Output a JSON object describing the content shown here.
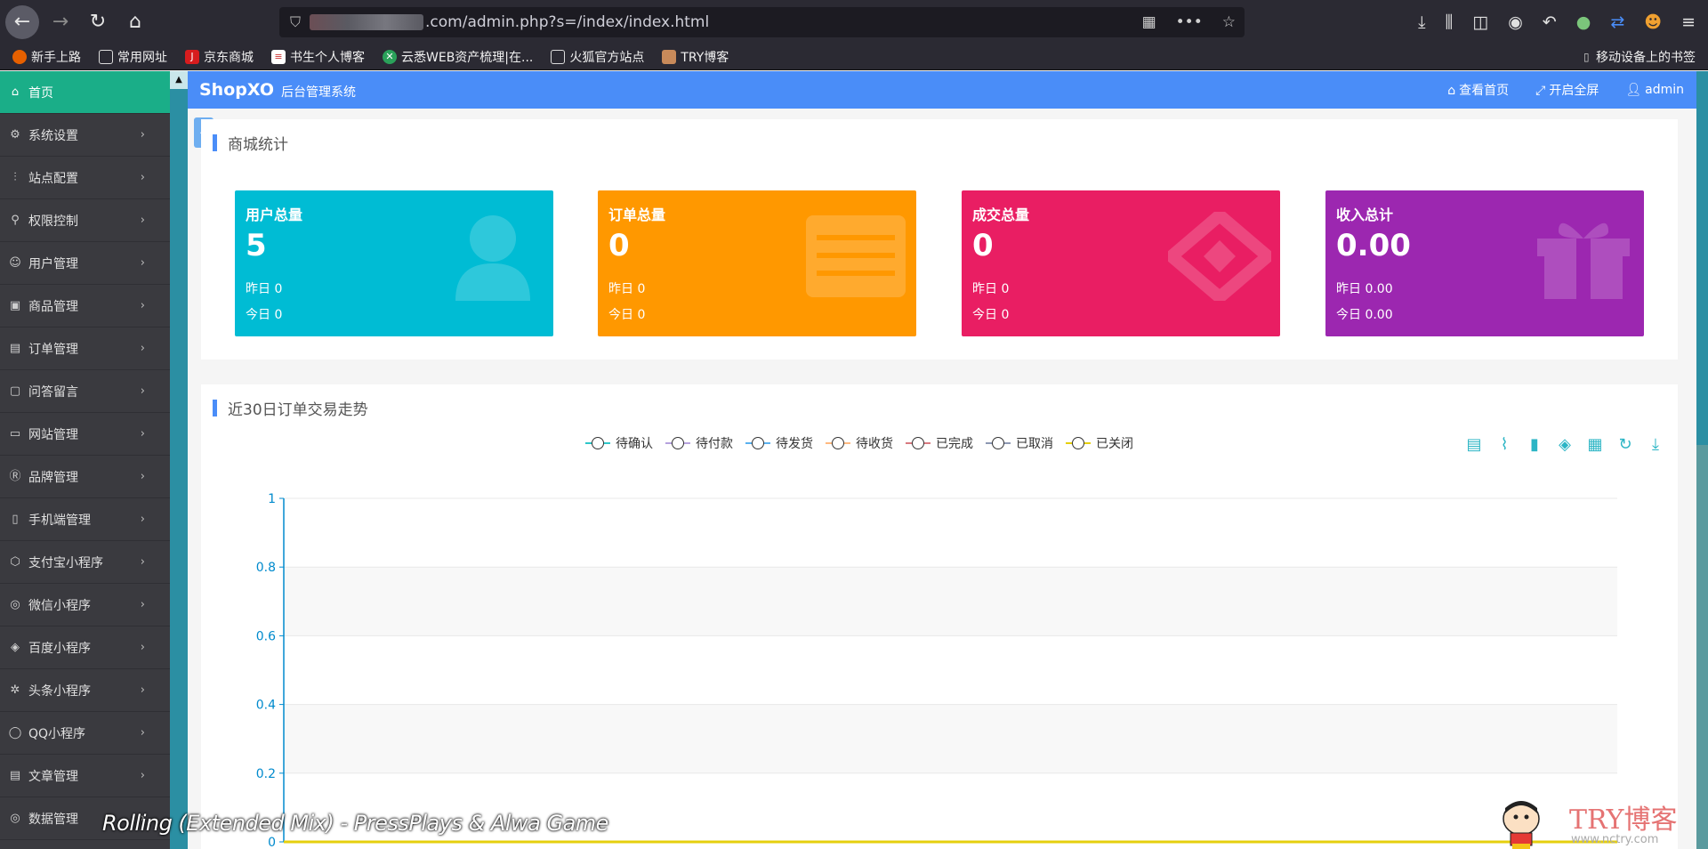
{
  "browser": {
    "url_suffix": ".com/admin.php?s=/index/index.html",
    "bookmarks": [
      "新手上路",
      "常用网址",
      "京东商城",
      "书生个人博客",
      "云悉WEB资产梳理|在...",
      "火狐官方站点",
      "TRY博客"
    ],
    "bookmark_right": "移动设备上的书签"
  },
  "sidebar": {
    "items": [
      {
        "label": "首页",
        "icon": "home-icon",
        "active": true
      },
      {
        "label": "系统设置",
        "icon": "gear-icon"
      },
      {
        "label": "站点配置",
        "icon": "sliders-icon"
      },
      {
        "label": "权限控制",
        "icon": "user-lock-icon"
      },
      {
        "label": "用户管理",
        "icon": "users-icon"
      },
      {
        "label": "商品管理",
        "icon": "shop-icon"
      },
      {
        "label": "订单管理",
        "icon": "order-icon"
      },
      {
        "label": "问答留言",
        "icon": "message-icon"
      },
      {
        "label": "网站管理",
        "icon": "website-icon"
      },
      {
        "label": "品牌管理",
        "icon": "brand-icon"
      },
      {
        "label": "手机端管理",
        "icon": "mobile-icon"
      },
      {
        "label": "支付宝小程序",
        "icon": "alipay-icon"
      },
      {
        "label": "微信小程序",
        "icon": "wechat-icon"
      },
      {
        "label": "百度小程序",
        "icon": "baidu-icon"
      },
      {
        "label": "头条小程序",
        "icon": "toutiao-icon"
      },
      {
        "label": "QQ小程序",
        "icon": "qq-icon"
      },
      {
        "label": "文章管理",
        "icon": "article-icon"
      },
      {
        "label": "数据管理",
        "icon": "database-icon"
      }
    ]
  },
  "header": {
    "brand": "ShopXO",
    "subtitle": "后台管理系统",
    "links": [
      "查看首页",
      "开启全屏",
      "admin"
    ]
  },
  "stats_panel": {
    "title": "商城统计",
    "cards": [
      {
        "label": "用户总量",
        "value": "5",
        "yesterday": "昨日 0",
        "today": "今日 0",
        "color": "#00bcd4",
        "icon": "user-icon"
      },
      {
        "label": "订单总量",
        "value": "0",
        "yesterday": "昨日 0",
        "today": "今日 0",
        "color": "#ff9800",
        "icon": "list-icon"
      },
      {
        "label": "成交总量",
        "value": "0",
        "yesterday": "昨日 0",
        "today": "今日 0",
        "color": "#e91e63",
        "icon": "deal-icon"
      },
      {
        "label": "收入总计",
        "value": "0.00",
        "yesterday": "昨日 0.00",
        "today": "今日 0.00",
        "color": "#9c27b0",
        "icon": "gift-icon"
      }
    ]
  },
  "trend_panel": {
    "title": "近30日订单交易走势",
    "chart_data": {
      "type": "line",
      "yticks": [
        "1",
        "0.8",
        "0.6",
        "0.4",
        "0.2",
        "0"
      ],
      "ylim": [
        0,
        1
      ],
      "series": [
        {
          "name": "待确认",
          "color": "#2ec7c9"
        },
        {
          "name": "待付款",
          "color": "#b6a2de"
        },
        {
          "name": "待发货",
          "color": "#5ab1ef"
        },
        {
          "name": "待收货",
          "color": "#ffb980"
        },
        {
          "name": "已完成",
          "color": "#d87a80"
        },
        {
          "name": "已取消",
          "color": "#8d98b3"
        },
        {
          "name": "已关闭",
          "color": "#e5cf0d"
        }
      ]
    }
  },
  "overlay": {
    "song": "Rolling (Extended Mix) - PressPlays & Alwa Game",
    "logo_text": "TRY博客",
    "logo_url": "www.nctry.com"
  }
}
